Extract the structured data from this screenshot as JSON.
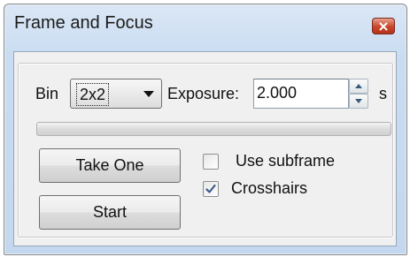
{
  "window": {
    "title": "Frame and Focus",
    "close_icon": "close-icon",
    "close_color": "#c9452a"
  },
  "bin": {
    "label": "Bin",
    "value": "2x2",
    "arrow_icon": "dropdown-arrow-icon"
  },
  "exposure": {
    "label": "Exposure:",
    "value": "2.000",
    "unit": "s",
    "spin_icons": [
      "spin-up-icon",
      "spin-down-icon"
    ]
  },
  "progress": {
    "fraction": 0.0,
    "fill_color": "#3fb23c"
  },
  "buttons": {
    "take_one": "Take One",
    "start": "Start"
  },
  "options": {
    "use_subframe": {
      "label": "Use subframe",
      "checked": false
    },
    "crosshairs": {
      "label": "Crosshairs",
      "checked": true
    }
  }
}
